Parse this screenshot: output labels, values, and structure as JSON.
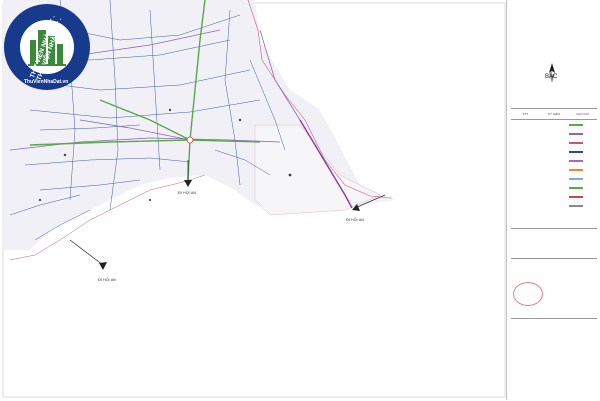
{
  "map": {
    "destinations": [
      "ĐI HỘI AN",
      "ĐI HỘI AN",
      "ĐI HỘI AN"
    ],
    "colors": {
      "main_road": "#5aa84a",
      "secondary_road": "#8a6aa8",
      "local_road": "#2b4d8c",
      "boundary": "#8e3ba0",
      "edge": "#c0607a",
      "block": "#ecebf3",
      "water": "#e9eef6"
    },
    "watermark": {
      "text": "THƯ VIỆN NHÀ ĐẤT · THƯ VIỆN NHÀ ĐẤT ·",
      "url": "ThuVienNhaDat.vn",
      "color": "#173a8c"
    }
  },
  "legend": {
    "north_label": "BẮC",
    "headers": [
      "STT",
      "KÝ HIỆU",
      "GHI CHÚ"
    ],
    "items": [
      {
        "label": "",
        "color": "#5aa84a"
      },
      {
        "label": "",
        "color": "#8a6aa8"
      },
      {
        "label": "",
        "color": "#c05a7a"
      },
      {
        "label": "",
        "color": "#2b4d8c"
      },
      {
        "label": "",
        "color": "#a06ac0"
      },
      {
        "label": "",
        "color": "#e08a3a"
      },
      {
        "label": "",
        "color": "#7ab0d8"
      },
      {
        "label": "",
        "color": "#5aa84a"
      },
      {
        "label": "",
        "color": "#c74a4a"
      },
      {
        "label": "",
        "color": "#8a8a8a"
      }
    ]
  }
}
